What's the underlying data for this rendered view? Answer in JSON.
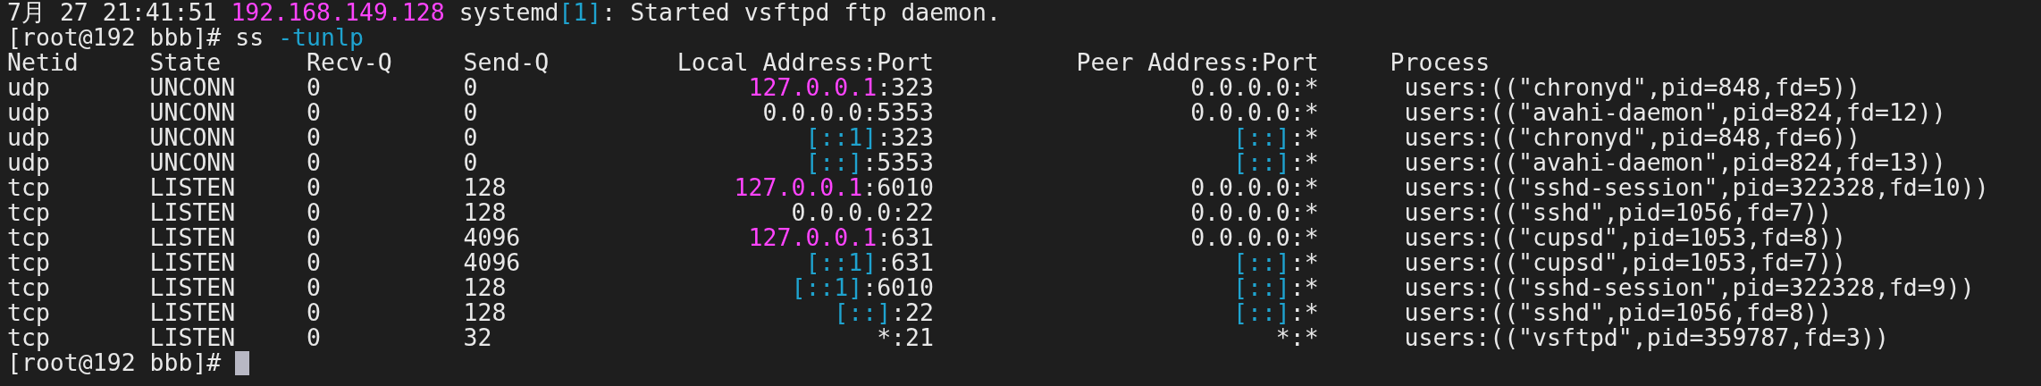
{
  "log_line": [
    {
      "text": "7月 27 21:41:51 ",
      "kind": "plain"
    },
    {
      "text": "192.168.149.128",
      "kind": "ip"
    },
    {
      "text": " systemd",
      "kind": "plain"
    },
    {
      "text": "[1]",
      "kind": "bracket"
    },
    {
      "text": ": Started vsftpd ftp daemon.",
      "kind": "plain"
    }
  ],
  "command_line": {
    "prompt": "[root@192 bbb]#",
    "command": "ss",
    "options": "-tunlp"
  },
  "table": {
    "columns": [
      "Netid",
      "State",
      "Recv-Q",
      "Send-Q",
      "Local Address:Port",
      "Peer Address:Port",
      "Process"
    ],
    "rows": [
      {
        "netid": "udp",
        "state": "UNCONN",
        "recv_q": "0",
        "send_q": "0",
        "local": {
          "host": "127.0.0.1",
          "kind": "ipv4_loopback",
          "port": ":323"
        },
        "peer": {
          "host": "0.0.0.0",
          "kind": "plain",
          "port": ":*"
        },
        "process": "users:((\"chronyd\",pid=848,fd=5))"
      },
      {
        "netid": "udp",
        "state": "UNCONN",
        "recv_q": "0",
        "send_q": "0",
        "local": {
          "host": "0.0.0.0",
          "kind": "plain",
          "port": ":5353"
        },
        "peer": {
          "host": "0.0.0.0",
          "kind": "plain",
          "port": ":*"
        },
        "process": "users:((\"avahi-daemon\",pid=824,fd=12))"
      },
      {
        "netid": "udp",
        "state": "UNCONN",
        "recv_q": "0",
        "send_q": "0",
        "local": {
          "host": "[::1]",
          "kind": "ipv6",
          "port": ":323"
        },
        "peer": {
          "host": "[::]",
          "kind": "ipv6",
          "port": ":*"
        },
        "process": "users:((\"chronyd\",pid=848,fd=6))"
      },
      {
        "netid": "udp",
        "state": "UNCONN",
        "recv_q": "0",
        "send_q": "0",
        "local": {
          "host": "[::]",
          "kind": "ipv6",
          "port": ":5353"
        },
        "peer": {
          "host": "[::]",
          "kind": "ipv6",
          "port": ":*"
        },
        "process": "users:((\"avahi-daemon\",pid=824,fd=13))"
      },
      {
        "netid": "tcp",
        "state": "LISTEN",
        "recv_q": "0",
        "send_q": "128",
        "local": {
          "host": "127.0.0.1",
          "kind": "ipv4_loopback",
          "port": ":6010"
        },
        "peer": {
          "host": "0.0.0.0",
          "kind": "plain",
          "port": ":*"
        },
        "process": "users:((\"sshd-session\",pid=322328,fd=10))"
      },
      {
        "netid": "tcp",
        "state": "LISTEN",
        "recv_q": "0",
        "send_q": "128",
        "local": {
          "host": "0.0.0.0",
          "kind": "plain",
          "port": ":22"
        },
        "peer": {
          "host": "0.0.0.0",
          "kind": "plain",
          "port": ":*"
        },
        "process": "users:((\"sshd\",pid=1056,fd=7))"
      },
      {
        "netid": "tcp",
        "state": "LISTEN",
        "recv_q": "0",
        "send_q": "4096",
        "local": {
          "host": "127.0.0.1",
          "kind": "ipv4_loopback",
          "port": ":631"
        },
        "peer": {
          "host": "0.0.0.0",
          "kind": "plain",
          "port": ":*"
        },
        "process": "users:((\"cupsd\",pid=1053,fd=8))"
      },
      {
        "netid": "tcp",
        "state": "LISTEN",
        "recv_q": "0",
        "send_q": "4096",
        "local": {
          "host": "[::1]",
          "kind": "ipv6",
          "port": ":631"
        },
        "peer": {
          "host": "[::]",
          "kind": "ipv6",
          "port": ":*"
        },
        "process": "users:((\"cupsd\",pid=1053,fd=7))"
      },
      {
        "netid": "tcp",
        "state": "LISTEN",
        "recv_q": "0",
        "send_q": "128",
        "local": {
          "host": "[::1]",
          "kind": "ipv6",
          "port": ":6010"
        },
        "peer": {
          "host": "[::]",
          "kind": "ipv6",
          "port": ":*"
        },
        "process": "users:((\"sshd-session\",pid=322328,fd=9))"
      },
      {
        "netid": "tcp",
        "state": "LISTEN",
        "recv_q": "0",
        "send_q": "128",
        "local": {
          "host": "[::]",
          "kind": "ipv6",
          "port": ":22"
        },
        "peer": {
          "host": "[::]",
          "kind": "ipv6",
          "port": ":*"
        },
        "process": "users:((\"sshd\",pid=1056,fd=8))"
      },
      {
        "netid": "tcp",
        "state": "LISTEN",
        "recv_q": "0",
        "send_q": "32",
        "local": {
          "host": "*",
          "kind": "plain",
          "port": ":21"
        },
        "peer": {
          "host": "*",
          "kind": "plain",
          "port": ":*"
        },
        "process": "users:((\"vsftpd\",pid=359787,fd=3))"
      }
    ]
  },
  "final_prompt": {
    "prompt": "[root@192 bbb]#",
    "cursor": true
  }
}
